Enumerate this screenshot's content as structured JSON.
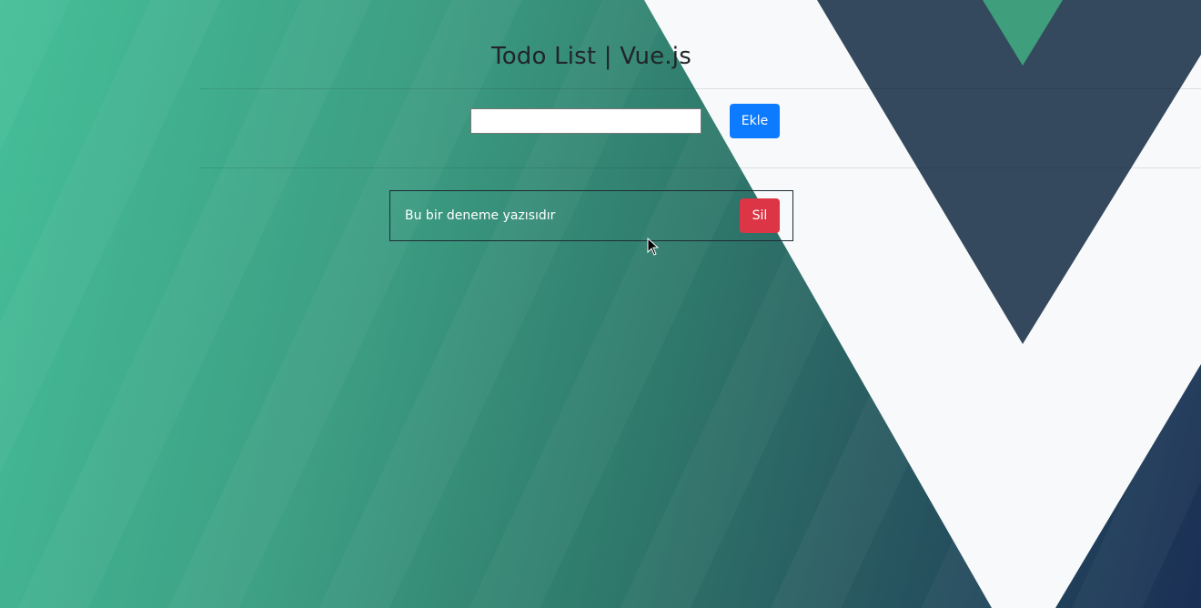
{
  "page": {
    "title": "Todo List | Vue.js"
  },
  "form": {
    "input_value": "",
    "input_placeholder": "",
    "add_label": "Ekle"
  },
  "todos": [
    {
      "text": "Bu bir deneme yazısıdır",
      "delete_label": "Sil"
    }
  ],
  "colors": {
    "add_button": "#0d7bff",
    "delete_button": "#dc3545",
    "vue_green": "#42b883",
    "vue_dark": "#35495e"
  }
}
